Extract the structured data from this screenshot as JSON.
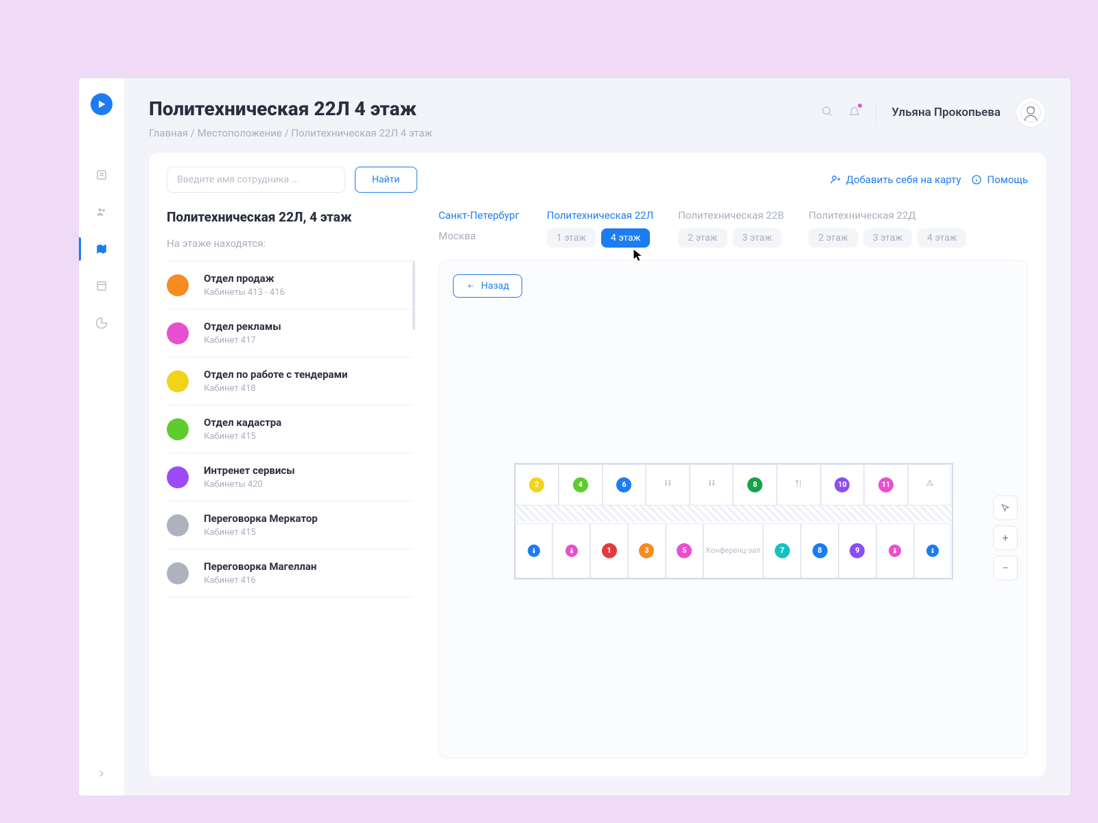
{
  "header": {
    "title": "Политехническая 22Л 4 этаж",
    "breadcrumbs": "Главная / Местоположение / Политехническая 22Л 4 этаж",
    "username": "Ульяна Прокопьева"
  },
  "toolbar": {
    "search_placeholder": "Введите имя сотрудника ...",
    "find_label": "Найти",
    "add_self_label": "Добавить себя на карту",
    "help_label": "Помощь"
  },
  "panel": {
    "title": "Политехническая 22Л, 4 этаж",
    "subtitle": "На этаже находятся:"
  },
  "departments": [
    {
      "name": "Отдел продаж",
      "room": "Кабинеты 413 - 416",
      "color": "#f68b1f"
    },
    {
      "name": "Отдел рекламы",
      "room": "Кабинет 417",
      "color": "#e94fd1"
    },
    {
      "name": "Отдел по работе с тендерами",
      "room": "Кабинет 418",
      "color": "#f3d31a"
    },
    {
      "name": "Отдел кадастра",
      "room": "Кабинет 415",
      "color": "#5ecb2e"
    },
    {
      "name": "Интренет сервисы",
      "room": "Кабинеты 420",
      "color": "#9c4cf7"
    },
    {
      "name": "Переговорка Меркатор",
      "room": "Кабинет 415",
      "color": "#adb2bc"
    },
    {
      "name": "Переговорка Магеллан",
      "room": "Кабинет 416",
      "color": "#adb2bc"
    }
  ],
  "cities": [
    {
      "name": "Санкт-Петербург",
      "active": true
    },
    {
      "name": "Москва",
      "active": false
    }
  ],
  "buildings": [
    {
      "name": "Политехническая 22Л",
      "active": true,
      "floors": [
        {
          "label": "1 этаж",
          "active": false
        },
        {
          "label": "4 этаж",
          "active": true
        }
      ]
    },
    {
      "name": "Политехническая 22В",
      "active": false,
      "floors": [
        {
          "label": "2 этаж",
          "active": false
        },
        {
          "label": "3 этаж",
          "active": false
        }
      ]
    },
    {
      "name": "Политехническая 22Д",
      "active": false,
      "floors": [
        {
          "label": "2 этаж",
          "active": false
        },
        {
          "label": "3 этаж",
          "active": false
        },
        {
          "label": "4 этаж",
          "active": false
        }
      ]
    }
  ],
  "map": {
    "back_label": "Назад",
    "conference_label": "Конференц-зал",
    "rooms_top": [
      {
        "n": "2",
        "color": "#f3d31a"
      },
      {
        "n": "4",
        "color": "#5ecb2e"
      },
      {
        "n": "6",
        "color": "#1c7cf2"
      },
      {
        "n": "",
        "icon": "wc"
      },
      {
        "n": "",
        "icon": "wc"
      },
      {
        "n": "8",
        "color": "#19a04b"
      },
      {
        "n": "",
        "icon": "fork"
      },
      {
        "n": "10",
        "color": "#8a4cf7"
      },
      {
        "n": "11",
        "color": "#e94fd1"
      },
      {
        "n": "",
        "icon": "hanger"
      }
    ],
    "rooms_bottom": [
      {
        "n": "",
        "icon": "wc-m"
      },
      {
        "n": "",
        "icon": "wc-f"
      },
      {
        "n": "1",
        "color": "#e23b3b"
      },
      {
        "n": "3",
        "color": "#f68b1f"
      },
      {
        "n": "5",
        "color": "#e94fd1"
      },
      {
        "n": "conf"
      },
      {
        "n": "7",
        "color": "#17c1c1"
      },
      {
        "n": "8",
        "color": "#1c7cf2"
      },
      {
        "n": "9",
        "color": "#8a4cf7"
      },
      {
        "n": "",
        "icon": "wc-f"
      },
      {
        "n": "",
        "icon": "wc-m"
      }
    ]
  }
}
